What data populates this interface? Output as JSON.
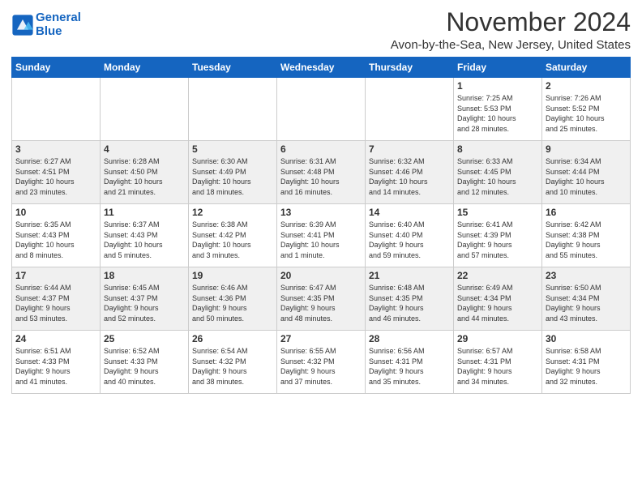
{
  "header": {
    "logo_line1": "General",
    "logo_line2": "Blue",
    "month": "November 2024",
    "location": "Avon-by-the-Sea, New Jersey, United States"
  },
  "weekdays": [
    "Sunday",
    "Monday",
    "Tuesday",
    "Wednesday",
    "Thursday",
    "Friday",
    "Saturday"
  ],
  "weeks": [
    [
      {
        "day": "",
        "info": ""
      },
      {
        "day": "",
        "info": ""
      },
      {
        "day": "",
        "info": ""
      },
      {
        "day": "",
        "info": ""
      },
      {
        "day": "",
        "info": ""
      },
      {
        "day": "1",
        "info": "Sunrise: 7:25 AM\nSunset: 5:53 PM\nDaylight: 10 hours\nand 28 minutes."
      },
      {
        "day": "2",
        "info": "Sunrise: 7:26 AM\nSunset: 5:52 PM\nDaylight: 10 hours\nand 25 minutes."
      }
    ],
    [
      {
        "day": "3",
        "info": "Sunrise: 6:27 AM\nSunset: 4:51 PM\nDaylight: 10 hours\nand 23 minutes."
      },
      {
        "day": "4",
        "info": "Sunrise: 6:28 AM\nSunset: 4:50 PM\nDaylight: 10 hours\nand 21 minutes."
      },
      {
        "day": "5",
        "info": "Sunrise: 6:30 AM\nSunset: 4:49 PM\nDaylight: 10 hours\nand 18 minutes."
      },
      {
        "day": "6",
        "info": "Sunrise: 6:31 AM\nSunset: 4:48 PM\nDaylight: 10 hours\nand 16 minutes."
      },
      {
        "day": "7",
        "info": "Sunrise: 6:32 AM\nSunset: 4:46 PM\nDaylight: 10 hours\nand 14 minutes."
      },
      {
        "day": "8",
        "info": "Sunrise: 6:33 AM\nSunset: 4:45 PM\nDaylight: 10 hours\nand 12 minutes."
      },
      {
        "day": "9",
        "info": "Sunrise: 6:34 AM\nSunset: 4:44 PM\nDaylight: 10 hours\nand 10 minutes."
      }
    ],
    [
      {
        "day": "10",
        "info": "Sunrise: 6:35 AM\nSunset: 4:43 PM\nDaylight: 10 hours\nand 8 minutes."
      },
      {
        "day": "11",
        "info": "Sunrise: 6:37 AM\nSunset: 4:43 PM\nDaylight: 10 hours\nand 5 minutes."
      },
      {
        "day": "12",
        "info": "Sunrise: 6:38 AM\nSunset: 4:42 PM\nDaylight: 10 hours\nand 3 minutes."
      },
      {
        "day": "13",
        "info": "Sunrise: 6:39 AM\nSunset: 4:41 PM\nDaylight: 10 hours\nand 1 minute."
      },
      {
        "day": "14",
        "info": "Sunrise: 6:40 AM\nSunset: 4:40 PM\nDaylight: 9 hours\nand 59 minutes."
      },
      {
        "day": "15",
        "info": "Sunrise: 6:41 AM\nSunset: 4:39 PM\nDaylight: 9 hours\nand 57 minutes."
      },
      {
        "day": "16",
        "info": "Sunrise: 6:42 AM\nSunset: 4:38 PM\nDaylight: 9 hours\nand 55 minutes."
      }
    ],
    [
      {
        "day": "17",
        "info": "Sunrise: 6:44 AM\nSunset: 4:37 PM\nDaylight: 9 hours\nand 53 minutes."
      },
      {
        "day": "18",
        "info": "Sunrise: 6:45 AM\nSunset: 4:37 PM\nDaylight: 9 hours\nand 52 minutes."
      },
      {
        "day": "19",
        "info": "Sunrise: 6:46 AM\nSunset: 4:36 PM\nDaylight: 9 hours\nand 50 minutes."
      },
      {
        "day": "20",
        "info": "Sunrise: 6:47 AM\nSunset: 4:35 PM\nDaylight: 9 hours\nand 48 minutes."
      },
      {
        "day": "21",
        "info": "Sunrise: 6:48 AM\nSunset: 4:35 PM\nDaylight: 9 hours\nand 46 minutes."
      },
      {
        "day": "22",
        "info": "Sunrise: 6:49 AM\nSunset: 4:34 PM\nDaylight: 9 hours\nand 44 minutes."
      },
      {
        "day": "23",
        "info": "Sunrise: 6:50 AM\nSunset: 4:34 PM\nDaylight: 9 hours\nand 43 minutes."
      }
    ],
    [
      {
        "day": "24",
        "info": "Sunrise: 6:51 AM\nSunset: 4:33 PM\nDaylight: 9 hours\nand 41 minutes."
      },
      {
        "day": "25",
        "info": "Sunrise: 6:52 AM\nSunset: 4:33 PM\nDaylight: 9 hours\nand 40 minutes."
      },
      {
        "day": "26",
        "info": "Sunrise: 6:54 AM\nSunset: 4:32 PM\nDaylight: 9 hours\nand 38 minutes."
      },
      {
        "day": "27",
        "info": "Sunrise: 6:55 AM\nSunset: 4:32 PM\nDaylight: 9 hours\nand 37 minutes."
      },
      {
        "day": "28",
        "info": "Sunrise: 6:56 AM\nSunset: 4:31 PM\nDaylight: 9 hours\nand 35 minutes."
      },
      {
        "day": "29",
        "info": "Sunrise: 6:57 AM\nSunset: 4:31 PM\nDaylight: 9 hours\nand 34 minutes."
      },
      {
        "day": "30",
        "info": "Sunrise: 6:58 AM\nSunset: 4:31 PM\nDaylight: 9 hours\nand 32 minutes."
      }
    ]
  ]
}
